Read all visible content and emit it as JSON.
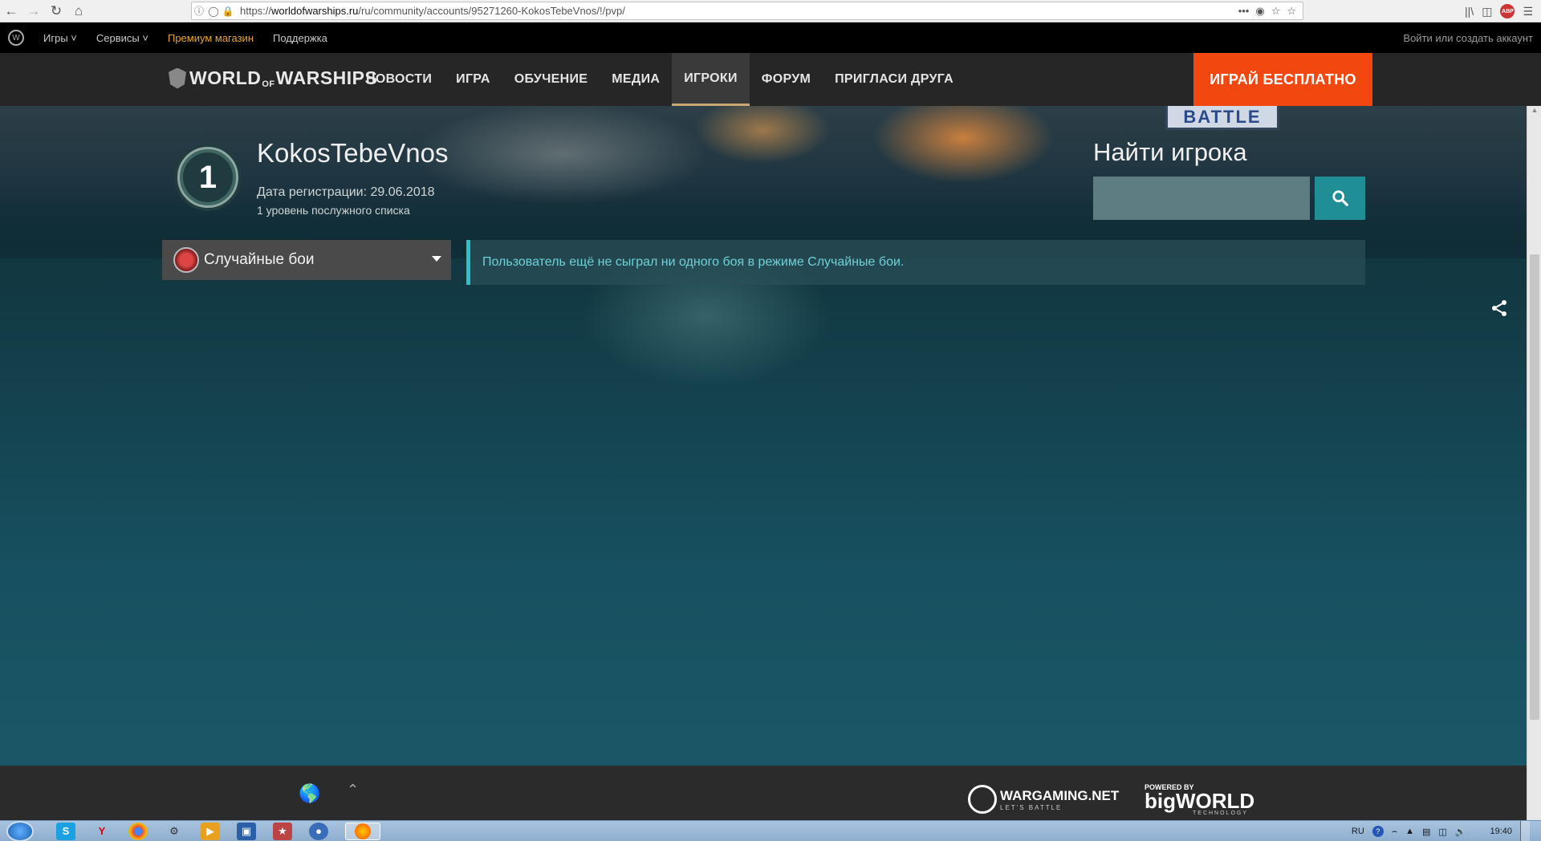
{
  "browser": {
    "url_prefix": "https://",
    "url_domain": "worldofwarships.ru",
    "url_path": "/ru/community/accounts/95271260-KokosTebeVnos/!/pvp/",
    "more_icon": "more-dots-icon",
    "abp_label": "ABP"
  },
  "wg_bar": {
    "games_label": "Игры",
    "services_label": "Сервисы",
    "premium_label": "Премиум магазин",
    "support_label": "Поддержка",
    "login_label": "Войти или создать аккаунт"
  },
  "nav": {
    "logo_world": "WORLD",
    "logo_of": "OF",
    "logo_warships": "WARSHIPS",
    "items": [
      {
        "label": "НОВОСТИ"
      },
      {
        "label": "ИГРА"
      },
      {
        "label": "ОБУЧЕНИЕ"
      },
      {
        "label": "МЕДИА"
      },
      {
        "label": "ИГРОКИ"
      },
      {
        "label": "ФОРУМ"
      },
      {
        "label": "ПРИГЛАСИ ДРУГА"
      }
    ],
    "active_item": "ИГРОКИ",
    "play_label": "ИГРАЙ БЕСПЛАТНО",
    "play_color": "#f2470f"
  },
  "hero": {
    "battle_label": "BATTLE"
  },
  "player": {
    "rank": "1",
    "name": "KokosTebeVnos",
    "registration": "Дата регистрации: 29.06.2018",
    "service_level": "1 уровень послужного списка"
  },
  "search": {
    "title": "Найти игрока",
    "value": "",
    "placeholder": ""
  },
  "mode": {
    "selected": "Случайные бои"
  },
  "notice": {
    "text": "Пользователь ещё не сыграл ни одного боя в режиме Случайные бои.",
    "accent": "#2ec0c6"
  },
  "footer": {
    "wg_name": "WARGAMING.NET",
    "wg_tagline": "LET'S BATTLE",
    "bw_powered": "POWERED BY",
    "bw_name": "bigWORLD",
    "bw_tech": "TECHNOLOGY"
  },
  "taskbar": {
    "lang": "RU",
    "clock": "19:40"
  }
}
